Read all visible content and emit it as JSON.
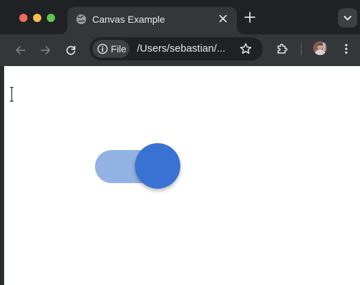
{
  "browser": {
    "tab_title": "Canvas Example",
    "site_chip_label": "File",
    "url_text": "/Users/sebastian/..."
  },
  "icons": {
    "tab_favicon": "globe-icon",
    "tab_close": "close-icon",
    "new_tab": "plus-icon",
    "tab_search": "chevron-down-icon",
    "back": "arrow-left-icon",
    "forward": "arrow-right-icon",
    "reload": "reload-icon",
    "site_info": "info-icon",
    "bookmark": "star-icon",
    "extensions": "puzzle-icon",
    "menu": "kebab-menu-icon"
  },
  "toggle": {
    "state": "on",
    "track_color": "#93b2e4",
    "knob_color": "#3a72d4"
  },
  "colors": {
    "titlebar": "#1f2225",
    "toolbar": "#34373a",
    "omnibox": "#202124",
    "page_bg": "#ffffff"
  }
}
